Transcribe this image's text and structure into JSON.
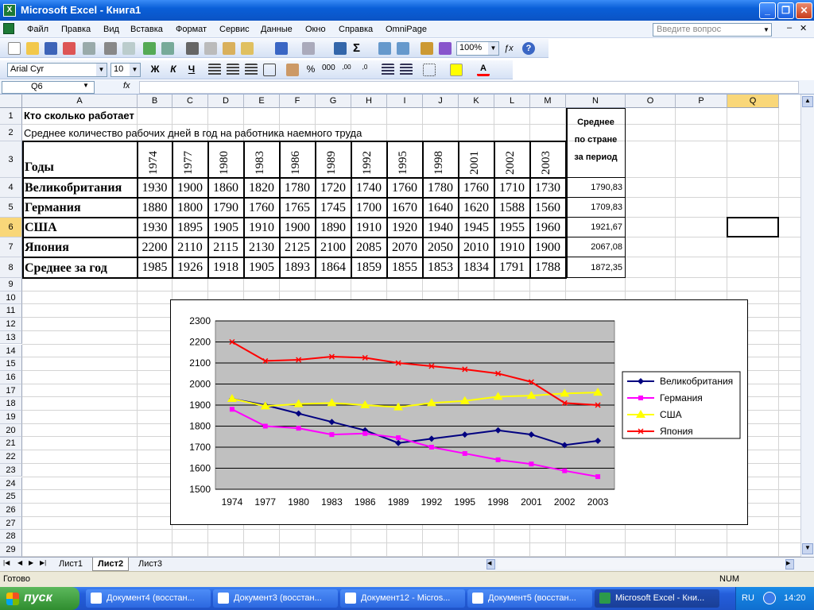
{
  "window": {
    "title": "Microsoft Excel - Книга1"
  },
  "menu": [
    "Файл",
    "Правка",
    "Вид",
    "Вставка",
    "Формат",
    "Сервис",
    "Данные",
    "Окно",
    "Справка",
    "OmniPage"
  ],
  "help_placeholder": "Введите вопрос",
  "toolbar": {
    "zoom": "100%",
    "font": "Arial Cyr",
    "size": "10",
    "bold": "Ж",
    "italic": "К",
    "underline": "Ч"
  },
  "formula": {
    "namebox": "Q6",
    "fx": "fx"
  },
  "columns": [
    "A",
    "B",
    "C",
    "D",
    "E",
    "F",
    "G",
    "H",
    "I",
    "J",
    "K",
    "L",
    "M",
    "N",
    "O",
    "P",
    "Q"
  ],
  "rows": [
    "1",
    "2",
    "3",
    "4",
    "5",
    "6",
    "7",
    "8",
    "9",
    "10",
    "11",
    "12",
    "13",
    "14",
    "15",
    "16",
    "17",
    "18",
    "19",
    "20",
    "21",
    "22",
    "23",
    "24",
    "25",
    "26",
    "27",
    "28",
    "29"
  ],
  "sheet": {
    "title": "Кто сколько работает",
    "subtitle": "Среднее количество рабочих дней в год на работника наемного труда",
    "years_label": "Годы",
    "years": [
      "1974",
      "1977",
      "1980",
      "1983",
      "1986",
      "1989",
      "1992",
      "1995",
      "1998",
      "2001",
      "2002",
      "2003"
    ],
    "avg_header": [
      "Среднее",
      "по стране",
      "за период"
    ],
    "table": [
      {
        "name": "Великобритания",
        "values": [
          "1930",
          "1900",
          "1860",
          "1820",
          "1780",
          "1720",
          "1740",
          "1760",
          "1780",
          "1760",
          "1710",
          "1730"
        ],
        "avg": "1790,83"
      },
      {
        "name": "Германия",
        "values": [
          "1880",
          "1800",
          "1790",
          "1760",
          "1765",
          "1745",
          "1700",
          "1670",
          "1640",
          "1620",
          "1588",
          "1560"
        ],
        "avg": "1709,83"
      },
      {
        "name": "США",
        "values": [
          "1930",
          "1895",
          "1905",
          "1910",
          "1900",
          "1890",
          "1910",
          "1920",
          "1940",
          "1945",
          "1955",
          "1960"
        ],
        "avg": "1921,67"
      },
      {
        "name": "Япония",
        "values": [
          "2200",
          "2110",
          "2115",
          "2130",
          "2125",
          "2100",
          "2085",
          "2070",
          "2050",
          "2010",
          "1910",
          "1900"
        ],
        "avg": "2067,08"
      },
      {
        "name": "Среднее за год",
        "values": [
          "1985",
          "1926",
          "1918",
          "1905",
          "1893",
          "1864",
          "1859",
          "1855",
          "1853",
          "1834",
          "1791",
          "1788"
        ],
        "avg": "1872,35"
      }
    ]
  },
  "chart_data": {
    "type": "line",
    "categories": [
      "1974",
      "1977",
      "1980",
      "1983",
      "1986",
      "1989",
      "1992",
      "1995",
      "1998",
      "2001",
      "2002",
      "2003"
    ],
    "ylim": [
      1500,
      2300
    ],
    "yticks": [
      "1500",
      "1600",
      "1700",
      "1800",
      "1900",
      "2000",
      "2100",
      "2200",
      "2300"
    ],
    "grid": true,
    "legend": "right",
    "series": [
      {
        "name": "Великобритания",
        "color": "#000080",
        "marker": "diamond",
        "values": [
          1930,
          1900,
          1860,
          1820,
          1780,
          1720,
          1740,
          1760,
          1780,
          1760,
          1710,
          1730
        ]
      },
      {
        "name": "Германия",
        "color": "#ff00ff",
        "marker": "square",
        "values": [
          1880,
          1800,
          1790,
          1760,
          1765,
          1745,
          1700,
          1670,
          1640,
          1620,
          1588,
          1560
        ]
      },
      {
        "name": "США",
        "color": "#ffff00",
        "marker": "triangle",
        "values": [
          1930,
          1895,
          1905,
          1910,
          1900,
          1890,
          1910,
          1920,
          1940,
          1945,
          1955,
          1960
        ]
      },
      {
        "name": "Япония",
        "color": "#ff0000",
        "marker": "x",
        "values": [
          2200,
          2110,
          2115,
          2130,
          2125,
          2100,
          2085,
          2070,
          2050,
          2010,
          1910,
          1900
        ]
      }
    ]
  },
  "sheettabs": [
    "Лист1",
    "Лист2",
    "Лист3"
  ],
  "status": {
    "ready": "Готово",
    "num": "NUM"
  },
  "taskbar": {
    "start": "пуск",
    "tasks": [
      "Документ4 (восстан...",
      "Документ3 (восстан...",
      "Документ12 - Micros...",
      "Документ5 (восстан...",
      "Microsoft Excel - Кни..."
    ],
    "lang": "RU",
    "clock": "14:20"
  }
}
